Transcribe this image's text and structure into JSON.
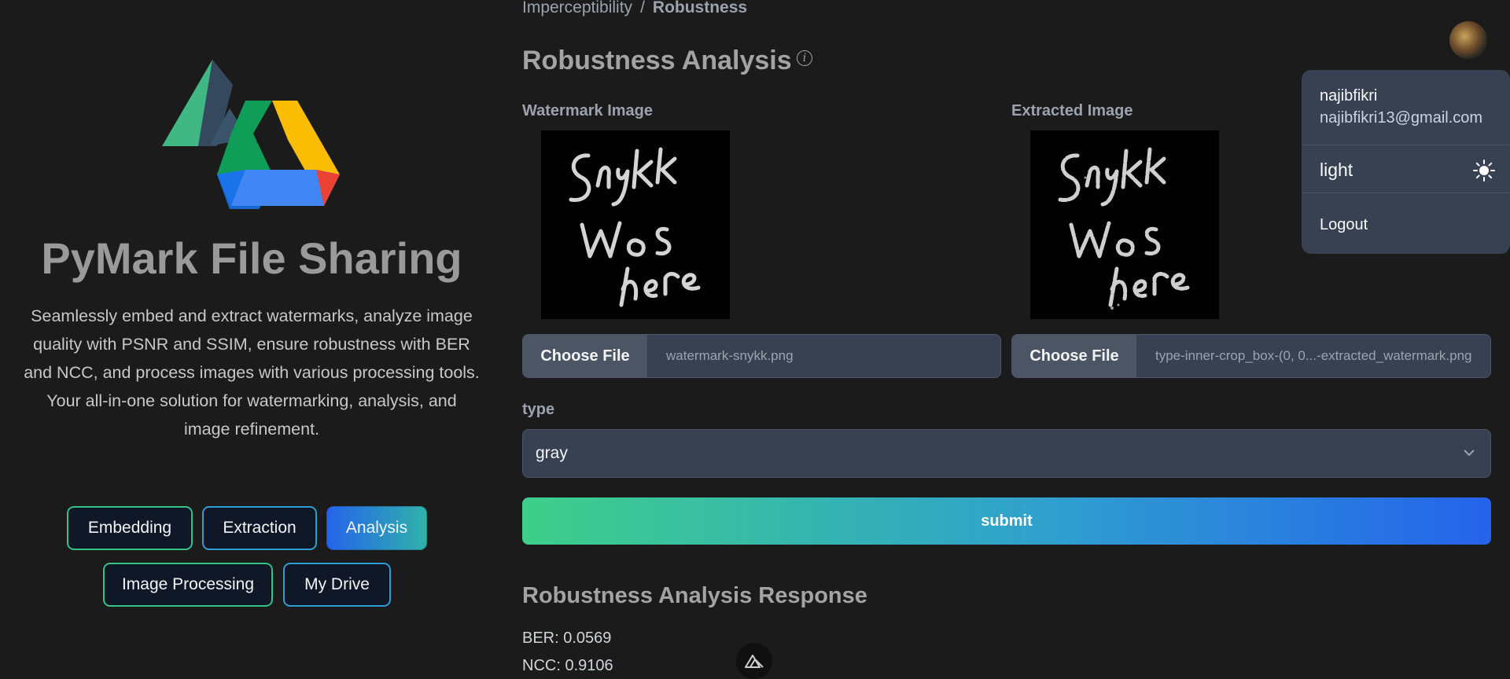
{
  "app": {
    "title": "PyMark File Sharing",
    "description": "Seamlessly embed and extract watermarks, analyze image quality with PSNR and SSIM, ensure robustness with BER and NCC, and process images with various processing tools. Your all-in-one solution for watermarking, analysis, and image refinement."
  },
  "nav": {
    "embedding": "Embedding",
    "extraction": "Extraction",
    "analysis": "Analysis",
    "image_processing": "Image Processing",
    "my_drive": "My Drive",
    "active": "Analysis"
  },
  "breadcrumb": {
    "parent": "Imperceptibility",
    "separator": "/",
    "current": "Robustness"
  },
  "page": {
    "title": "Robustness Analysis",
    "info_icon": "i"
  },
  "watermark": {
    "label": "Watermark Image",
    "button": "Choose File",
    "filename": "watermark-snykk.png"
  },
  "extracted": {
    "label": "Extracted Image",
    "button": "Choose File",
    "filename": "type-inner-crop_box-(0, 0...-extracted_watermark.png"
  },
  "type": {
    "label": "type",
    "value": "gray"
  },
  "submit_label": "submit",
  "response": {
    "title": "Robustness Analysis Response",
    "ber": "BER: 0.0569",
    "ncc": "NCC: 0.9106"
  },
  "user_menu": {
    "username": "najibfikri",
    "email": "najibfikri13@gmail.com",
    "theme_label": "light",
    "logout": "Logout"
  },
  "icons": {
    "info": "info-icon",
    "chevron": "chevron-down-icon",
    "sun": "sun-icon",
    "nuxt": "nuxt-icon"
  },
  "colors": {
    "background": "#1b1b1b",
    "accent_start": "#3ecf8a",
    "accent_end": "#2563eb",
    "panel": "#374151"
  }
}
